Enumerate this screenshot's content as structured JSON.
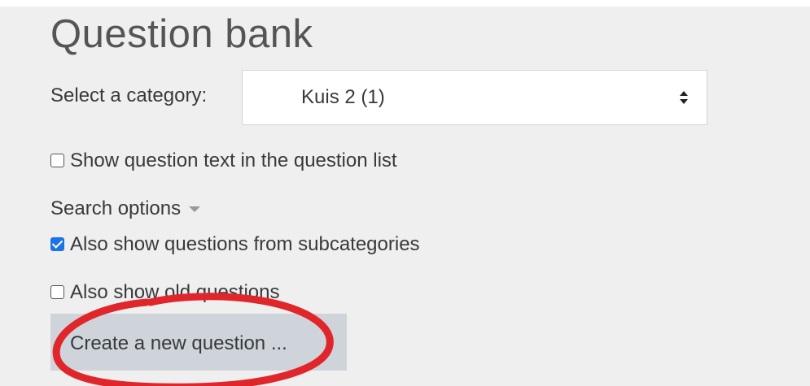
{
  "page": {
    "top_text": "",
    "title": "Question bank"
  },
  "category": {
    "label": "Select a category:",
    "selected": "Kuis 2 (1)"
  },
  "options": {
    "show_question_text": {
      "label": "Show question text in the question list",
      "checked": false
    },
    "search_options_label": "Search options",
    "subcategories": {
      "label": "Also show questions from subcategories",
      "checked": true
    },
    "old_questions": {
      "label": "Also show old questions",
      "checked": false
    }
  },
  "actions": {
    "create_label": "Create a new question ..."
  },
  "colors": {
    "panel_bg": "#efefef",
    "checkbox_checked": "#1a73e8",
    "button_bg": "#ced4da",
    "annotation_circle": "#e0262b"
  },
  "icons": [
    "select-arrows-icon",
    "caret-down-icon",
    "checkbox-icon"
  ]
}
